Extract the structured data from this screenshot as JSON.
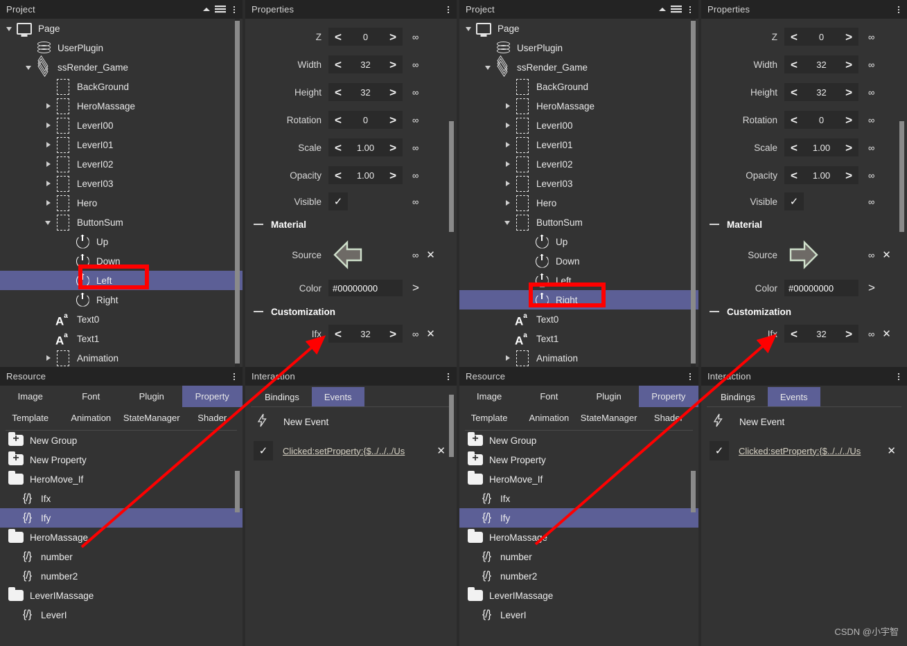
{
  "panels": {
    "project_title": "Project",
    "properties_title": "Properties",
    "resource_title": "Resource",
    "interaction_title": "Interaction"
  },
  "tree_left": {
    "items": [
      {
        "label": "Page",
        "icon": "monitor-icon",
        "indent": 0,
        "twist": "open",
        "selected": false
      },
      {
        "label": "UserPlugin",
        "icon": "database-icon",
        "indent": 1,
        "twist": "none",
        "selected": false
      },
      {
        "label": "ssRender_Game",
        "icon": "layers-icon",
        "indent": 1,
        "twist": "open",
        "selected": false
      },
      {
        "label": "BackGround",
        "icon": "dashed-box-icon",
        "indent": 2,
        "twist": "none",
        "selected": false
      },
      {
        "label": "HeroMassage",
        "icon": "dashed-box-icon",
        "indent": 2,
        "twist": "closed",
        "selected": false
      },
      {
        "label": "LeverI00",
        "icon": "dashed-box-icon",
        "indent": 2,
        "twist": "closed",
        "selected": false
      },
      {
        "label": "LeverI01",
        "icon": "dashed-box-icon",
        "indent": 2,
        "twist": "closed",
        "selected": false
      },
      {
        "label": "LeverI02",
        "icon": "dashed-box-icon",
        "indent": 2,
        "twist": "closed",
        "selected": false
      },
      {
        "label": "LeverI03",
        "icon": "dashed-box-icon",
        "indent": 2,
        "twist": "closed",
        "selected": false
      },
      {
        "label": "Hero",
        "icon": "dashed-box-icon",
        "indent": 2,
        "twist": "closed",
        "selected": false
      },
      {
        "label": "ButtonSum",
        "icon": "dashed-box-icon",
        "indent": 2,
        "twist": "open",
        "selected": false
      },
      {
        "label": "Up",
        "icon": "power-icon",
        "indent": 3,
        "twist": "none",
        "selected": false
      },
      {
        "label": "Down",
        "icon": "power-icon",
        "indent": 3,
        "twist": "none",
        "selected": false
      },
      {
        "label": "Left",
        "icon": "power-icon",
        "indent": 3,
        "twist": "none",
        "selected": true
      },
      {
        "label": "Right",
        "icon": "power-icon",
        "indent": 3,
        "twist": "none",
        "selected": false
      },
      {
        "label": "Text0",
        "icon": "text-icon",
        "indent": 2,
        "twist": "none",
        "selected": false
      },
      {
        "label": "Text1",
        "icon": "text-icon",
        "indent": 2,
        "twist": "none",
        "selected": false
      },
      {
        "label": "Animation",
        "icon": "dashed-box-icon",
        "indent": 2,
        "twist": "closed",
        "selected": false
      }
    ]
  },
  "tree_right": {
    "items": [
      {
        "label": "Page",
        "icon": "monitor-icon",
        "indent": 0,
        "twist": "open",
        "selected": false
      },
      {
        "label": "UserPlugin",
        "icon": "database-icon",
        "indent": 1,
        "twist": "none",
        "selected": false
      },
      {
        "label": "ssRender_Game",
        "icon": "layers-icon",
        "indent": 1,
        "twist": "open",
        "selected": false
      },
      {
        "label": "BackGround",
        "icon": "dashed-box-icon",
        "indent": 2,
        "twist": "none",
        "selected": false
      },
      {
        "label": "HeroMassage",
        "icon": "dashed-box-icon",
        "indent": 2,
        "twist": "closed",
        "selected": false
      },
      {
        "label": "LeverI00",
        "icon": "dashed-box-icon",
        "indent": 2,
        "twist": "closed",
        "selected": false
      },
      {
        "label": "LeverI01",
        "icon": "dashed-box-icon",
        "indent": 2,
        "twist": "closed",
        "selected": false
      },
      {
        "label": "LeverI02",
        "icon": "dashed-box-icon",
        "indent": 2,
        "twist": "closed",
        "selected": false
      },
      {
        "label": "LeverI03",
        "icon": "dashed-box-icon",
        "indent": 2,
        "twist": "closed",
        "selected": false
      },
      {
        "label": "Hero",
        "icon": "dashed-box-icon",
        "indent": 2,
        "twist": "closed",
        "selected": false
      },
      {
        "label": "ButtonSum",
        "icon": "dashed-box-icon",
        "indent": 2,
        "twist": "open",
        "selected": false
      },
      {
        "label": "Up",
        "icon": "power-icon",
        "indent": 3,
        "twist": "none",
        "selected": false
      },
      {
        "label": "Down",
        "icon": "power-icon",
        "indent": 3,
        "twist": "none",
        "selected": false
      },
      {
        "label": "Left",
        "icon": "power-icon",
        "indent": 3,
        "twist": "none",
        "selected": false
      },
      {
        "label": "Right",
        "icon": "power-icon",
        "indent": 3,
        "twist": "none",
        "selected": true
      },
      {
        "label": "Text0",
        "icon": "text-icon",
        "indent": 2,
        "twist": "none",
        "selected": false
      },
      {
        "label": "Text1",
        "icon": "text-icon",
        "indent": 2,
        "twist": "none",
        "selected": false
      },
      {
        "label": "Animation",
        "icon": "dashed-box-icon",
        "indent": 2,
        "twist": "closed",
        "selected": false
      }
    ]
  },
  "properties_left": {
    "fields": [
      {
        "label": "Z",
        "value": "0"
      },
      {
        "label": "Width",
        "value": "32"
      },
      {
        "label": "Height",
        "value": "32"
      },
      {
        "label": "Rotation",
        "value": "0"
      },
      {
        "label": "Scale",
        "value": "1.00"
      },
      {
        "label": "Opacity",
        "value": "1.00"
      }
    ],
    "visible_label": "Visible",
    "visible_checked": "✓",
    "material_section": "Material",
    "source_label": "Source",
    "source_image": "arrow-left-sprite",
    "color_label": "Color",
    "color_value": "#00000000",
    "customization_section": "Customization",
    "ifx_label": "Ifx",
    "ifx_value": "32"
  },
  "properties_right": {
    "fields": [
      {
        "label": "Z",
        "value": "0"
      },
      {
        "label": "Width",
        "value": "32"
      },
      {
        "label": "Height",
        "value": "32"
      },
      {
        "label": "Rotation",
        "value": "0"
      },
      {
        "label": "Scale",
        "value": "1.00"
      },
      {
        "label": "Opacity",
        "value": "1.00"
      }
    ],
    "visible_label": "Visible",
    "visible_checked": "✓",
    "material_section": "Material",
    "source_label": "Source",
    "source_image": "arrow-right-sprite",
    "color_label": "Color",
    "color_value": "#00000000",
    "customization_section": "Customization",
    "ifx_label": "Ifx",
    "ifx_value": "32"
  },
  "resource": {
    "tabs_row1": [
      "Image",
      "Font",
      "Plugin",
      "Property"
    ],
    "tabs_row2": [
      "Template",
      "Animation",
      "StateManager",
      "Shader"
    ],
    "active_tab": "Property",
    "items": [
      {
        "label": "New Group",
        "icon": "folder-plus-icon",
        "selected": false
      },
      {
        "label": "New Property",
        "icon": "folder-plus-icon",
        "selected": false
      },
      {
        "label": "HeroMove_If",
        "icon": "folder-icon",
        "selected": false
      },
      {
        "label": "Ifx",
        "icon": "brace-icon",
        "selected": false
      },
      {
        "label": "Ify",
        "icon": "brace-icon",
        "selected": true
      },
      {
        "label": "HeroMassage",
        "icon": "folder-icon",
        "selected": false
      },
      {
        "label": "number",
        "icon": "brace-icon",
        "selected": false
      },
      {
        "label": "number2",
        "icon": "brace-icon",
        "selected": false
      },
      {
        "label": "LeverIMassage",
        "icon": "folder-icon",
        "selected": false
      },
      {
        "label": "LeverI",
        "icon": "brace-icon",
        "selected": false
      }
    ]
  },
  "interaction": {
    "tabs": [
      "Bindings",
      "Events"
    ],
    "active_tab": "Events",
    "new_event_label": "New Event",
    "new_event_icon": "lightning-icon",
    "event_checked": "✓",
    "event_link": "Clicked:setProperty:{$../../../Us",
    "event_delete_icon": "close-icon"
  },
  "annotations": {
    "accent_red": "#ff0000",
    "selection_purple": "#5c5f96",
    "watermark": "CSDN @小宇智"
  }
}
